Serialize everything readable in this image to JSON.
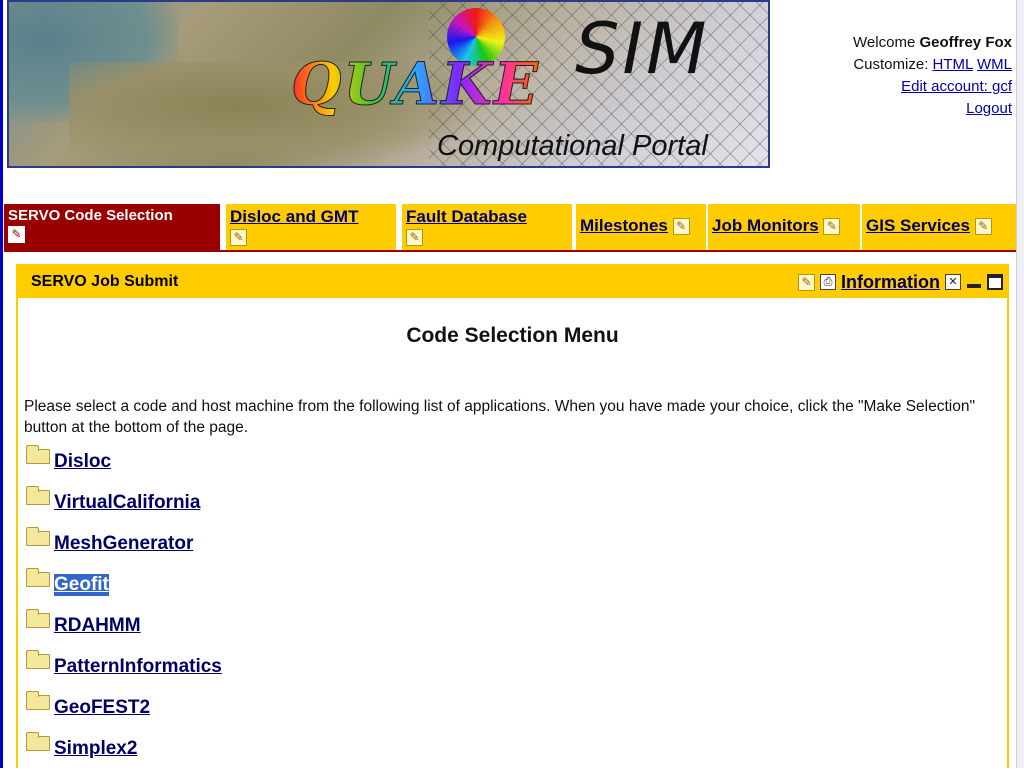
{
  "banner": {
    "logo_quake": "QUAKE",
    "logo_sim": "SIM",
    "subtitle": "Computational Portal"
  },
  "user": {
    "welcome_prefix": "Welcome",
    "name": "Geoffrey Fox",
    "customize_label": "Customize:",
    "html_link": "HTML",
    "wml_link": "WML",
    "edit_account": "Edit account: gcf",
    "logout": "Logout"
  },
  "tabs": [
    {
      "label": "SERVO Code Selection",
      "active": true
    },
    {
      "label": "Disloc and GMT",
      "active": false
    },
    {
      "label": "Fault Database",
      "active": false
    },
    {
      "label": "Milestones",
      "active": false
    },
    {
      "label": "Job Monitors",
      "active": false
    },
    {
      "label": "GIS Services",
      "active": false
    }
  ],
  "portlet": {
    "title": "SERVO Job Submit",
    "info_link": "Information",
    "heading": "Code Selection Menu",
    "description": "Please select a code and host machine from the following list of applications. When you have made your choice, click the \"Make Selection\" button at the bottom of the page.",
    "apps": [
      {
        "label": "Disloc",
        "selected": false
      },
      {
        "label": "VirtualCalifornia",
        "selected": false
      },
      {
        "label": "MeshGenerator",
        "selected": false
      },
      {
        "label": "Geofit",
        "selected": true
      },
      {
        "label": "RDAHMM",
        "selected": false
      },
      {
        "label": "PatternInformatics",
        "selected": false
      },
      {
        "label": "GeoFEST2",
        "selected": false
      },
      {
        "label": "Simplex2",
        "selected": false
      }
    ]
  },
  "icons": {
    "edit": "pencil-icon",
    "print": "printer-icon",
    "close": "close-box-icon",
    "minimize": "minimize-icon",
    "maximize": "maximize-icon",
    "folder": "folder-icon"
  },
  "colors": {
    "tab_active": "#990000",
    "tab_inactive": "#ffcc00",
    "link": "#000066",
    "selection": "#3366cc"
  }
}
